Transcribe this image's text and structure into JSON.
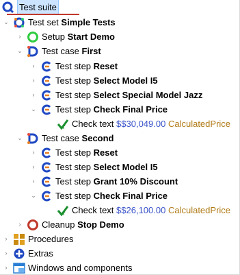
{
  "tree": {
    "root_label": "Test suite",
    "testset": {
      "prefix": "Test set",
      "name": "Simple Tests"
    },
    "setup": {
      "prefix": "Setup",
      "name": "Start Demo"
    },
    "case1": {
      "prefix": "Test case",
      "name": "First",
      "steps": [
        {
          "prefix": "Test step",
          "name": "Reset"
        },
        {
          "prefix": "Test step",
          "name": "Select Model I5"
        },
        {
          "prefix": "Test step",
          "name": "Select Special Model Jazz"
        },
        {
          "prefix": "Test step",
          "name": "Check Final Price"
        }
      ],
      "check": {
        "prefix": "Check text",
        "value": "$$30,049.00",
        "variable": "CalculatedPrice"
      }
    },
    "case2": {
      "prefix": "Test case",
      "name": "Second",
      "steps": [
        {
          "prefix": "Test step",
          "name": "Reset"
        },
        {
          "prefix": "Test step",
          "name": "Select Model I5"
        },
        {
          "prefix": "Test step",
          "name": "Grant 10% Discount"
        },
        {
          "prefix": "Test step",
          "name": "Check Final Price"
        }
      ],
      "check": {
        "prefix": "Check text",
        "value": "$$26,100.00",
        "variable": "CalculatedPrice"
      }
    },
    "cleanup": {
      "prefix": "Cleanup",
      "name": "Stop Demo"
    },
    "procedures": "Procedures",
    "extras": "Extras",
    "windows": "Windows and components"
  },
  "colors": {
    "selection": "#cce4ff",
    "value": "#3a53c9",
    "variable": "#b07a15",
    "step_icon": "#1f48c2"
  }
}
